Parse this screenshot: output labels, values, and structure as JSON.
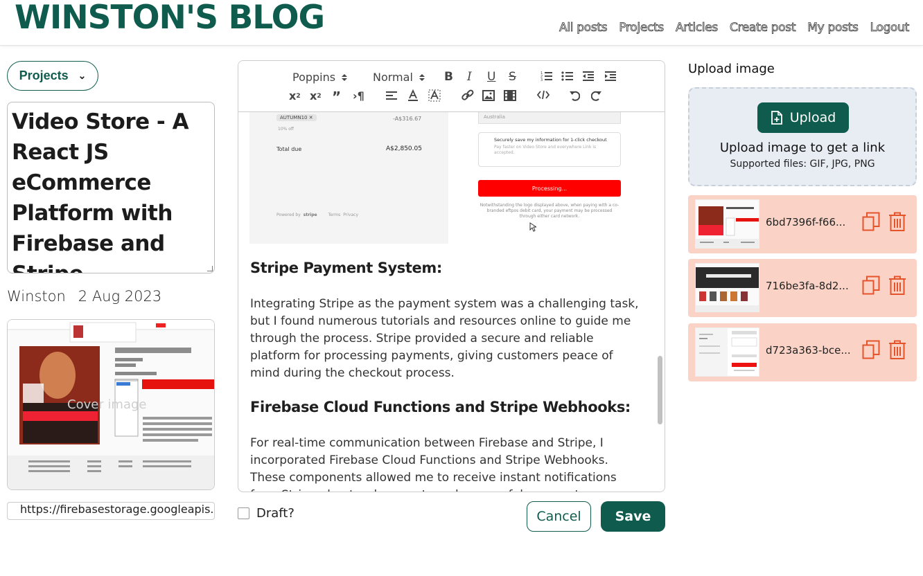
{
  "header": {
    "brand": "WINSTON'S BLOG",
    "nav": [
      "All posts",
      "Projects",
      "Articles",
      "Create post",
      "My posts",
      "Logout"
    ]
  },
  "sidebar_left": {
    "category_selected": "Projects",
    "title": "Video Store - A React JS eCommerce Platform with Firebase and Stripe",
    "author": "Winston",
    "date": "2 Aug 2023",
    "cover_label": "Cover image",
    "cover_url": "https://firebasestorage.googleapis.c"
  },
  "toolbar": {
    "font": "Poppins",
    "size": "Normal"
  },
  "editor": {
    "heading1": "Stripe Payment System:",
    "para1": "Integrating Stripe as the payment system was a challenging task, but I found numerous tutorials and resources online to guide me through the process. Stripe provided a secure and reliable platform for processing payments, giving customers peace of mind during the checkout process.",
    "heading2": "Firebase Cloud Functions and Stripe Webhooks:",
    "para2": "For real-time communication between Firebase and Stripe, I incorporated Firebase Cloud Functions and Stripe Webhooks. These components allowed me to receive instant notifications from Stripe about order events and successful payments.",
    "embedded_screenshot": {
      "coupon": "AUTUMN10",
      "discount_label": "10% off",
      "discount_amount": "-A$316.67",
      "total_label": "Total due",
      "total_value": "A$2,850.05",
      "country": "Australia",
      "save_info_title": "Securely save my information for 1-click checkout",
      "save_info_sub": "Pay faster on Video Store and everywhere Link is accepted.",
      "processing": "Processing...",
      "notice": "Notwithstanding the logo displayed above, when paying with a co-branded eftpos debit card, your payment may be processed through either card network.",
      "footer_powered": "Powered by",
      "footer_stripe": "stripe",
      "footer_terms": "Terms",
      "footer_privacy": "Privacy"
    }
  },
  "footer_actions": {
    "draft_label": "Draft?",
    "cancel": "Cancel",
    "save": "Save"
  },
  "upload": {
    "title": "Upload image",
    "button": "Upload",
    "main_text": "Upload image to get a link",
    "sub_text": "Supported files: GIF, JPG, PNG",
    "images": [
      {
        "name": "6bd7396f-f66..."
      },
      {
        "name": "716be3fa-8d2..."
      },
      {
        "name": "d723a363-bce..."
      }
    ]
  },
  "colors": {
    "brand": "#0f5c4e",
    "card_bg": "#fbd3c6",
    "icon_accent": "#e5532b",
    "dropzone_bg": "#e8edf3"
  }
}
